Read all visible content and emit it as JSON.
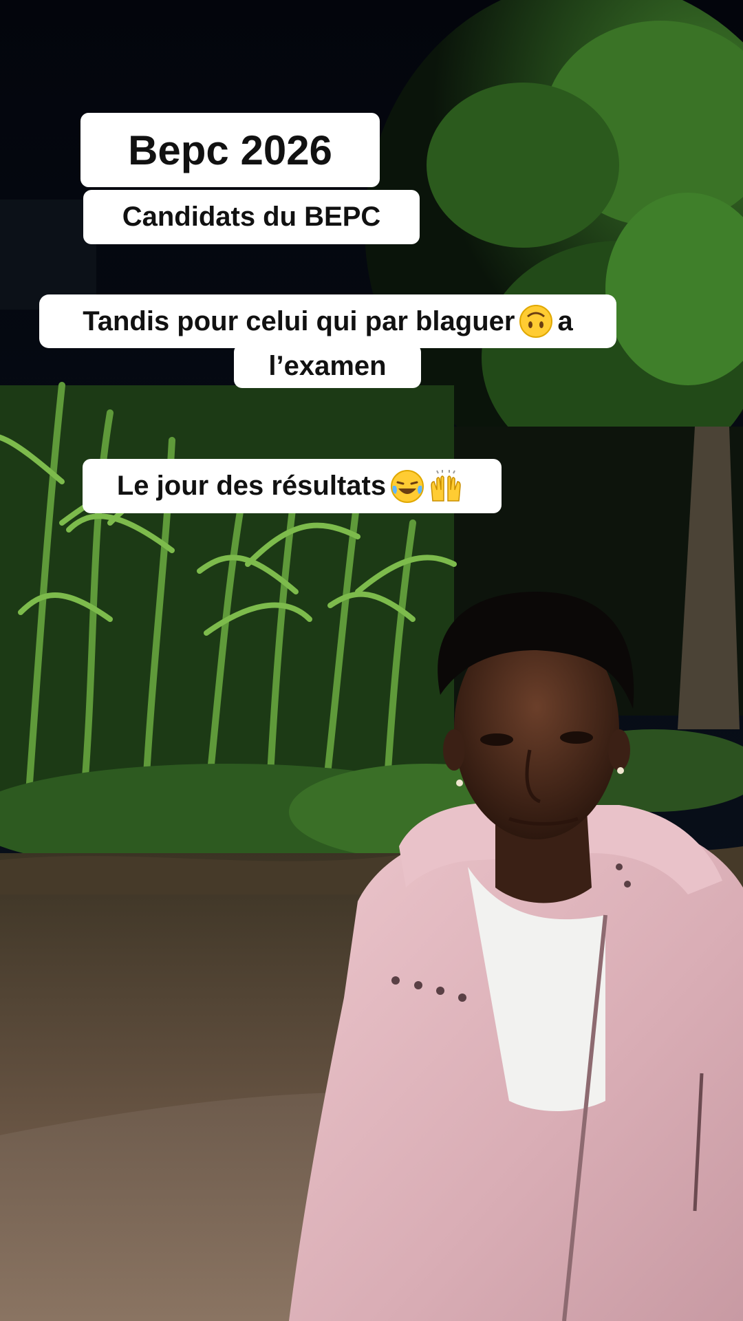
{
  "captions": {
    "title": "Bepc 2026",
    "subtitle": "Candidats du BEPC",
    "line1_part1": "Tandis pour celui qui par blaguer",
    "line1_part2": "a",
    "line2": "l’examen",
    "results": "Le jour des résultats"
  },
  "icons": {
    "line1_emoji": "upside-down-face-emoji",
    "results_emoji_1": "tears-of-joy-emoji",
    "results_emoji_2": "raising-hands-emoji"
  },
  "colors": {
    "caption_background": "#ffffff",
    "caption_text": "#111111",
    "night_sky": "#05070d",
    "jacket": "#e4bcc3",
    "shirt": "#f2f2f0",
    "foliage": "#2f6b1e",
    "ground": "#4a3a2a"
  }
}
